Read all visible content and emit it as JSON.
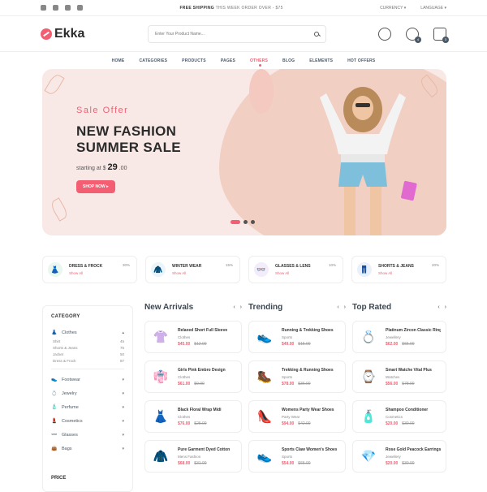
{
  "topbar": {
    "social_icons": [
      "facebook-icon",
      "twitter-icon",
      "instagram-icon",
      "linkedin-icon"
    ],
    "promo_bold": "FREE SHIPPING",
    "promo_rest": "THIS WEEK ORDER OVER - $75",
    "currency": "CURRENCY ▾",
    "language": "LANGUAGE ▾"
  },
  "header": {
    "logo": "Ekka",
    "search_placeholder": "Enter Your Product Name...",
    "wishlist_count": "4",
    "cart_count": "3"
  },
  "nav": [
    "HOME",
    "CATEGORIES",
    "PRODUCTS",
    "PAGES",
    "OTHERS",
    "BLOG",
    "ELEMENTS",
    "HOT OFFERS"
  ],
  "hero": {
    "sale_label": "Sale Offer",
    "title_line1": "NEW FASHION",
    "title_line2": "SUMMER SALE",
    "price_prefix": "starting at $",
    "price": "29",
    "price_suffix": ".00",
    "button": "SHOP NOW ▸"
  },
  "categories": [
    {
      "title": "DRESS & FROCK",
      "sub": "Show All",
      "discount": "30%",
      "icon": "👗",
      "color": "#e9f7ef"
    },
    {
      "title": "WINTER WEAR",
      "sub": "Show All",
      "discount": "15%",
      "icon": "🧥",
      "color": "#eaf4fb"
    },
    {
      "title": "GLASSES & LENS",
      "sub": "Show All",
      "discount": "10%",
      "icon": "👓",
      "color": "#f3ecfb"
    },
    {
      "title": "SHORTS & JEANS",
      "sub": "Show All",
      "discount": "20%",
      "icon": "👖",
      "color": "#eaf0fb"
    }
  ],
  "sidebar": {
    "head": "CATEGORY",
    "clothes": "Clothes",
    "sub": [
      {
        "name": "Shirt",
        "count": "45"
      },
      {
        "name": "Shorts & Jeans",
        "count": "75"
      },
      {
        "name": "Jacket",
        "count": "50"
      },
      {
        "name": "Dress & Frock",
        "count": "87"
      }
    ],
    "items": [
      {
        "name": "Footwear",
        "icon": "👟",
        "color": "#6aa8e6"
      },
      {
        "name": "Jewelry",
        "icon": "💍",
        "color": "#b28be6"
      },
      {
        "name": "Perfume",
        "icon": "🧴",
        "color": "#6ab0e6"
      },
      {
        "name": "Cosmetics",
        "icon": "💄",
        "color": "#f35e73"
      },
      {
        "name": "Glasses",
        "icon": "👓",
        "color": "#6a7ae6"
      },
      {
        "name": "Bags",
        "icon": "👜",
        "color": "#f38a5e"
      }
    ],
    "price_head": "PRICE"
  },
  "columns": [
    {
      "title": "New Arrivals",
      "products": [
        {
          "name": "Relaxed Short Full Sleeve",
          "cat": "Clothes",
          "new": "$45.00",
          "old": "$12.00",
          "icon": "👚",
          "bg": "#fff"
        },
        {
          "name": "Girls Pink Embro Design",
          "cat": "Clothes",
          "new": "$61.00",
          "old": "$9.00",
          "icon": "👘",
          "bg": "#fff"
        },
        {
          "name": "Black Floral Wrap Midi",
          "cat": "Clothes",
          "new": "$76.00",
          "old": "$25.00",
          "icon": "👗",
          "bg": "#fff"
        },
        {
          "name": "Pure Garment Dyed Cotton",
          "cat": "Mens Fashion",
          "new": "$68.00",
          "old": "$31.00",
          "icon": "🧥",
          "bg": "#fff"
        }
      ]
    },
    {
      "title": "Trending",
      "products": [
        {
          "name": "Running & Trekking Shoes",
          "cat": "Sports",
          "new": "$49.00",
          "old": "$15.00",
          "icon": "👟",
          "bg": "#fff"
        },
        {
          "name": "Trekking & Running Shoes",
          "cat": "Sports",
          "new": "$78.00",
          "old": "$36.00",
          "icon": "🥾",
          "bg": "#fff"
        },
        {
          "name": "Womens Party Wear Shoes",
          "cat": "Party Wear",
          "new": "$94.00",
          "old": "$42.00",
          "icon": "👠",
          "bg": "#fff"
        },
        {
          "name": "Sports Claw Women's Shoes",
          "cat": "Sports",
          "new": "$54.00",
          "old": "$65.00",
          "icon": "👟",
          "bg": "#fff"
        }
      ]
    },
    {
      "title": "Top Rated",
      "products": [
        {
          "name": "Platinum Zircon Classic Ring",
          "cat": "Jewellery",
          "new": "$62.00",
          "old": "$65.00",
          "icon": "💍",
          "bg": "#fff"
        },
        {
          "name": "Smart Watche Vital Plus",
          "cat": "Watches",
          "new": "$56.00",
          "old": "$78.00",
          "icon": "⌚",
          "bg": "#fff"
        },
        {
          "name": "Shampoo Conditioner",
          "cat": "Cosmetics",
          "new": "$20.00",
          "old": "$30.00",
          "icon": "🧴",
          "bg": "#fff"
        },
        {
          "name": "Rose Gold Peacock Earrings",
          "cat": "Jewellery",
          "new": "$20.00",
          "old": "$30.00",
          "icon": "💎",
          "bg": "#fff"
        }
      ]
    }
  ]
}
